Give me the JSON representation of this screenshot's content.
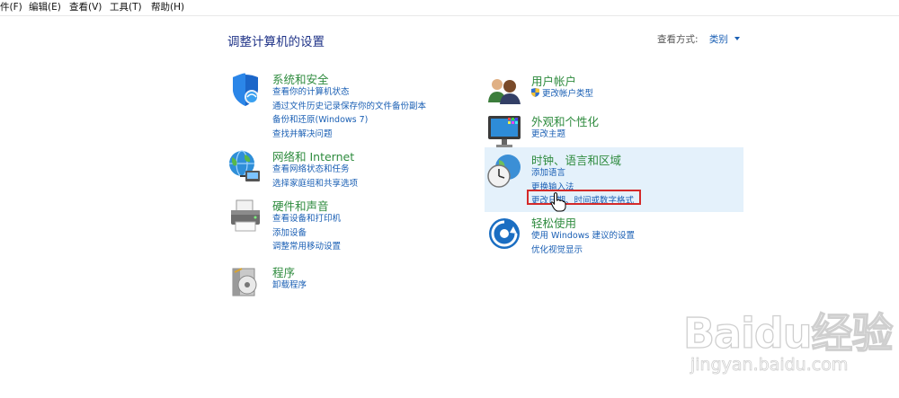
{
  "menu": [
    {
      "label": "件(F)"
    },
    {
      "label": "编辑(E)"
    },
    {
      "label": "查看(V)"
    },
    {
      "label": "工具(T)"
    },
    {
      "label": "帮助(H)"
    }
  ],
  "page_title": "调整计算机的设置",
  "view_by": {
    "label": "查看方式:",
    "value": "类别"
  },
  "categories": [
    {
      "title": "系统和安全",
      "icon": "shield-icon",
      "links": [
        "查看你的计算机状态",
        "通过文件历史记录保存你的文件备份副本",
        "备份和还原(Windows 7)",
        "查找并解决问题"
      ]
    },
    {
      "title": "网络和 Internet",
      "icon": "globe-network-icon",
      "links": [
        "查看网络状态和任务",
        "选择家庭组和共享选项"
      ]
    },
    {
      "title": "硬件和声音",
      "icon": "printer-icon",
      "links": [
        "查看设备和打印机",
        "添加设备",
        "调整常用移动设置"
      ]
    },
    {
      "title": "程序",
      "icon": "programs-disc-icon",
      "links": [
        "卸载程序"
      ]
    },
    {
      "title": "用户帐户",
      "icon": "users-icon",
      "links": [
        "更改帐户类型"
      ]
    },
    {
      "title": "外观和个性化",
      "icon": "monitor-icon",
      "links": [
        "更改主题"
      ]
    },
    {
      "title": "时钟、语言和区域",
      "icon": "clock-globe-icon",
      "links": [
        "添加语言",
        "更换输入法",
        "更改日期、时间或数字格式"
      ]
    },
    {
      "title": "轻松使用",
      "icon": "ease-of-access-icon",
      "links": [
        "使用 Windows 建议的设置",
        "优化视觉显示"
      ]
    }
  ],
  "watermark": {
    "brand": "Baidu经验",
    "url": "jingyan.baidu.com"
  },
  "colors": {
    "category_title": "#2e8b3e",
    "link": "#1a5fb4",
    "page_title": "#1e3287",
    "highlight_border": "#d42a2a",
    "hover_bg": "#e4f1fb"
  }
}
